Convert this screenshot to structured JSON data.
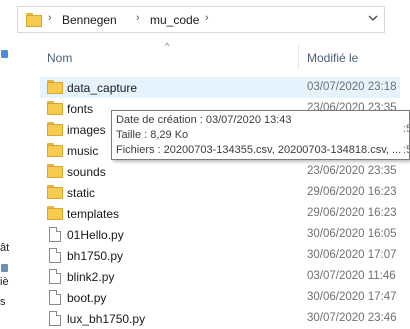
{
  "address_bar": {
    "parts": [
      "Bennegen",
      "mu_code"
    ],
    "separator": "›",
    "dropdown_icon": "chevron-down-icon"
  },
  "columns": {
    "name": "Nom",
    "modified": "Modifié le",
    "sort_indicator": "^"
  },
  "nav_fragments": [
    "ât",
    "iè",
    "s"
  ],
  "rows": [
    {
      "name": "data_capture",
      "date": "03/07/2020 23:18",
      "type": "folder",
      "selected": true
    },
    {
      "name": "fonts",
      "date": "23/06/2020 23:35",
      "type": "folder"
    },
    {
      "name": "images",
      "date": "",
      "type": "folder"
    },
    {
      "name": "music",
      "date": "",
      "type": "folder"
    },
    {
      "name": "sounds",
      "date": "23/06/2020 23:35",
      "type": "folder"
    },
    {
      "name": "static",
      "date": "29/06/2020 16:23",
      "type": "folder"
    },
    {
      "name": "templates",
      "date": "29/06/2020 16:23",
      "type": "folder"
    },
    {
      "name": "01Hello.py",
      "date": "30/06/2020 16:05",
      "type": "file"
    },
    {
      "name": "bh1750.py",
      "date": "30/06/2020 17:07",
      "type": "file"
    },
    {
      "name": "blink2.py",
      "date": "03/07/2020 11:46",
      "type": "file"
    },
    {
      "name": "boot.py",
      "date": "30/06/2020 17:47",
      "type": "file"
    },
    {
      "name": "lux_bh1750.py",
      "date": "30/07/2020 23:46",
      "type": "file"
    }
  ],
  "tooltip": {
    "created": "Date de création : 03/07/2020 13:43",
    "size": "Taille : 8,29 Ko",
    "files": "Fichiers : 20200703-134355.csv, 20200703-134818.csv, ..."
  },
  "peek": [
    ":5",
    ":5"
  ],
  "colors": {
    "selection": "#e5f3ff",
    "folder": "#f7cb50",
    "header_text": "#4c607a",
    "date_text": "#707070"
  }
}
